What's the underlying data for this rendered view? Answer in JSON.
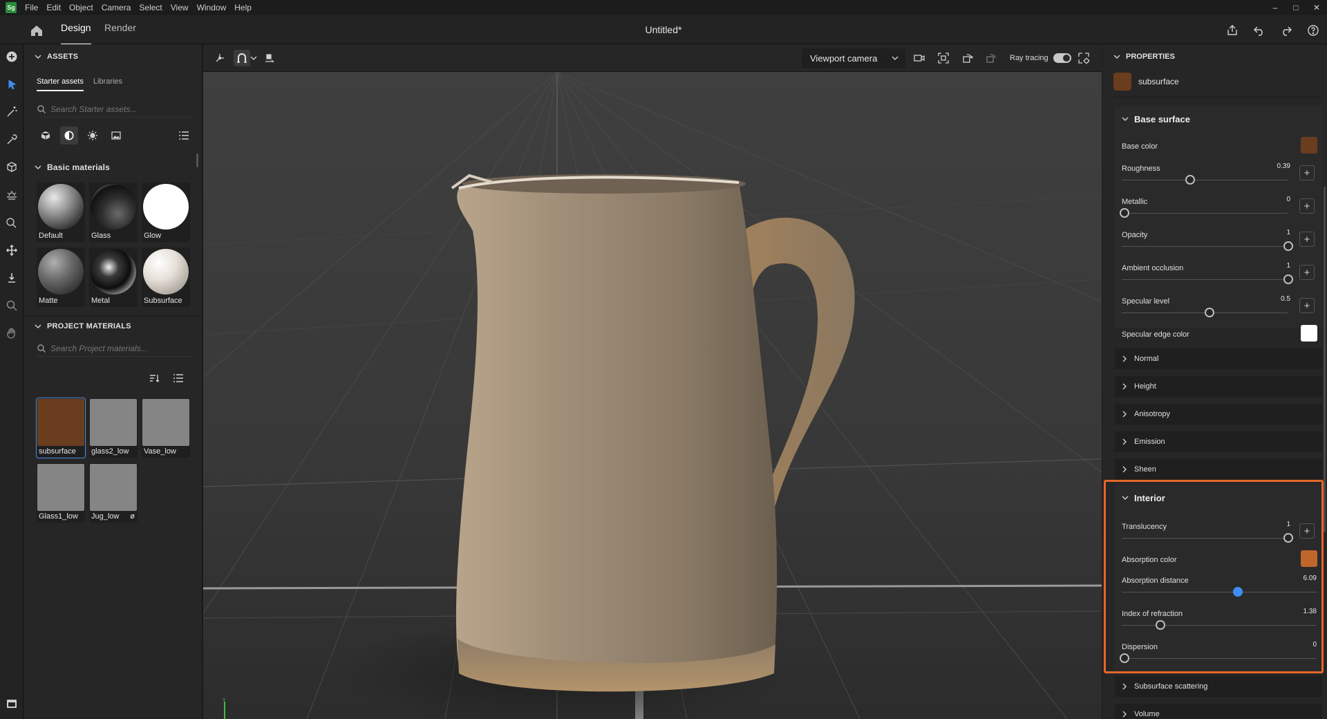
{
  "app": {
    "logo_text": "Sg",
    "menu": [
      "File",
      "Edit",
      "Object",
      "Camera",
      "Select",
      "View",
      "Window",
      "Help"
    ],
    "title": "Untitled*",
    "tabs": [
      {
        "label": "Design",
        "active": true
      },
      {
        "label": "Render",
        "active": false
      }
    ]
  },
  "assets": {
    "header": "ASSETS",
    "subtabs": [
      {
        "label": "Starter assets",
        "active": true
      },
      {
        "label": "Libraries",
        "active": false
      }
    ],
    "search_placeholder": "Search Starter assets...",
    "basic_header": "Basic materials",
    "basic_materials": [
      {
        "label": "Default"
      },
      {
        "label": "Glass"
      },
      {
        "label": "Glow"
      },
      {
        "label": "Matte"
      },
      {
        "label": "Metal"
      },
      {
        "label": "Subsurface"
      }
    ],
    "project_header": "PROJECT MATERIALS",
    "project_search_placeholder": "Search Project materials...",
    "project_materials": [
      {
        "label": "subsurface",
        "color": "#6a3d1f",
        "selected": true
      },
      {
        "label": "glass2_low",
        "color": "#858585",
        "selected": false
      },
      {
        "label": "Vase_low",
        "color": "#858585",
        "selected": false
      },
      {
        "label": "Glass1_low",
        "color": "#858585",
        "selected": false
      },
      {
        "label": "Jug_low",
        "color": "#858585",
        "selected": false,
        "badge": "ø"
      }
    ]
  },
  "viewport": {
    "camera": "Viewport camera",
    "ray_tracing_label": "Ray tracing",
    "ray_tracing_on": true
  },
  "properties": {
    "header": "PROPERTIES",
    "material_name": "subsurface",
    "material_color": "#6a3d1f",
    "base_surface": {
      "title": "Base surface",
      "base_color_label": "Base color",
      "base_color": "#6a3d1f",
      "roughness_label": "Roughness",
      "roughness": "0.39",
      "metallic_label": "Metallic",
      "metallic": "0",
      "opacity_label": "Opacity",
      "opacity": "1",
      "ao_label": "Ambient occlusion",
      "ao": "1",
      "specular_label": "Specular level",
      "specular": "0.5",
      "edge_color_label": "Specular edge color",
      "edge_color": "#ffffff"
    },
    "collapsed_top": [
      "Normal",
      "Height",
      "Anisotropy",
      "Emission",
      "Sheen"
    ],
    "interior": {
      "title": "Interior",
      "translucency_label": "Translucency",
      "translucency": "1",
      "absorption_color_label": "Absorption color",
      "absorption_color": "#c0662a",
      "absorption_distance_label": "Absorption distance",
      "absorption_distance": "6.09",
      "ior_label": "Index of refraction",
      "ior": "1.38",
      "dispersion_label": "Dispersion",
      "dispersion": "0"
    },
    "collapsed_bottom": [
      "Subsurface scattering",
      "Volume"
    ]
  }
}
